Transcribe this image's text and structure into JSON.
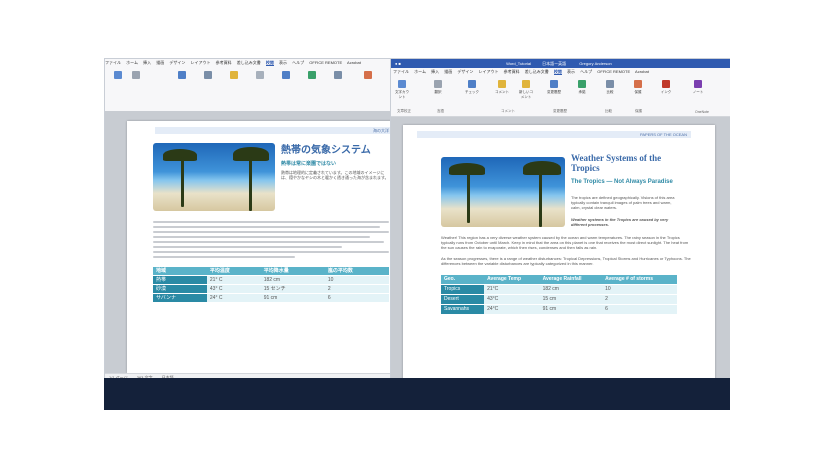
{
  "right_window": {
    "title": "Word_Tutorial",
    "title_mid": "日本語ー英語",
    "title_right": "Gregory Anderson",
    "menu": [
      "ファイル",
      "ホーム",
      "挿入",
      "描画",
      "デザイン",
      "レイアウト",
      "参考資料",
      "差し込み文書",
      "校閲",
      "表示",
      "ヘルプ",
      "OFFICE REMOTE",
      "Acrobat"
    ],
    "active_menu": "校閲",
    "ribbon_buttons": [
      "文字カウント",
      "翻訳",
      "チェック",
      "コメント",
      "新しいコメント",
      "変更履歴",
      "承諾",
      "比較",
      "保護",
      "インク",
      "ノート"
    ],
    "group_labels": [
      "文章校正",
      "言語",
      "コメント",
      "変更履歴",
      "比較",
      "保護",
      "OneNote"
    ],
    "header_text": "PAPERS OF THE OCEAN",
    "doc_title": "Weather Systems of the Tropics",
    "subtitle": "The Tropics — Not Always Paradise",
    "body_intro": "The tropics are defined geographically. Visions of this area typically contain tranquil images of palm trees and warm, calm, crystal clear waters.",
    "caption": "Weather systems in the Tropics are caused by very different processes.",
    "paragraph": "Weather! This region has a very diverse weather system caused by the ocean and warm temperatures. The rainy season in the Tropics typically runs from October until March. Keep in mind that the area on this planet is one that receives the most direct sunlight. The heat from the sun causes the rain to evaporate, which then rises, condenses and then falls as rain.",
    "paragraph2": "As the season progresses, there is a range of weather disturbances: Tropical Depressions, Tropical Storms and Hurricanes or Typhoons. The differences between the variable disturbances are typically categorized in this manner.",
    "table": {
      "headers": [
        "Geo.",
        "Average Temp",
        "Average Rainfall",
        "Average # of storms"
      ],
      "rows": [
        [
          "Tropics",
          "21°C",
          "182 cm",
          "10"
        ],
        [
          "Desert",
          "43°C",
          "15 cm",
          "2"
        ],
        [
          "Savannahs",
          "24°C",
          "91 cm",
          "6"
        ]
      ]
    },
    "status": [
      "1/1 ページ",
      "363 文字",
      "英語 (米国)",
      "フォーカス"
    ]
  },
  "left_window": {
    "menu": [
      "ファイル",
      "ホーム",
      "挿入",
      "描画",
      "デザイン",
      "レイアウト",
      "参考資料",
      "差し込み文書",
      "校閲",
      "表示",
      "ヘルプ",
      "OFFICE REMOTE",
      "Acrobat"
    ],
    "active_menu": "校閲",
    "header_text": "海の大洋",
    "doc_title": "熱帯の気象システム",
    "subtitle": "熱帯は常に楽園ではない",
    "body_intro": "熱帯は地理的に定義されています。この地域のイメージには、穏やかなヤシの木と暖かく透き通った海が含まれます。",
    "table": {
      "headers": [
        "地域",
        "平均温度",
        "平均降水量",
        "嵐の平均数"
      ],
      "rows": [
        [
          "熱帯",
          "21° C",
          "182 cm",
          "10"
        ],
        [
          "砂漠",
          "43° C",
          "15 センチ",
          "2"
        ],
        [
          "サバンナ",
          "24° C",
          "91 cm",
          "6"
        ]
      ]
    },
    "status": [
      "1/1 ページ",
      "363 文字",
      "日本語"
    ]
  },
  "colors": {
    "accent": "#2f5ab0",
    "table_header": "#5ab3c9",
    "table_first_col": "#2a8aa5",
    "title": "#3a6aa9"
  }
}
